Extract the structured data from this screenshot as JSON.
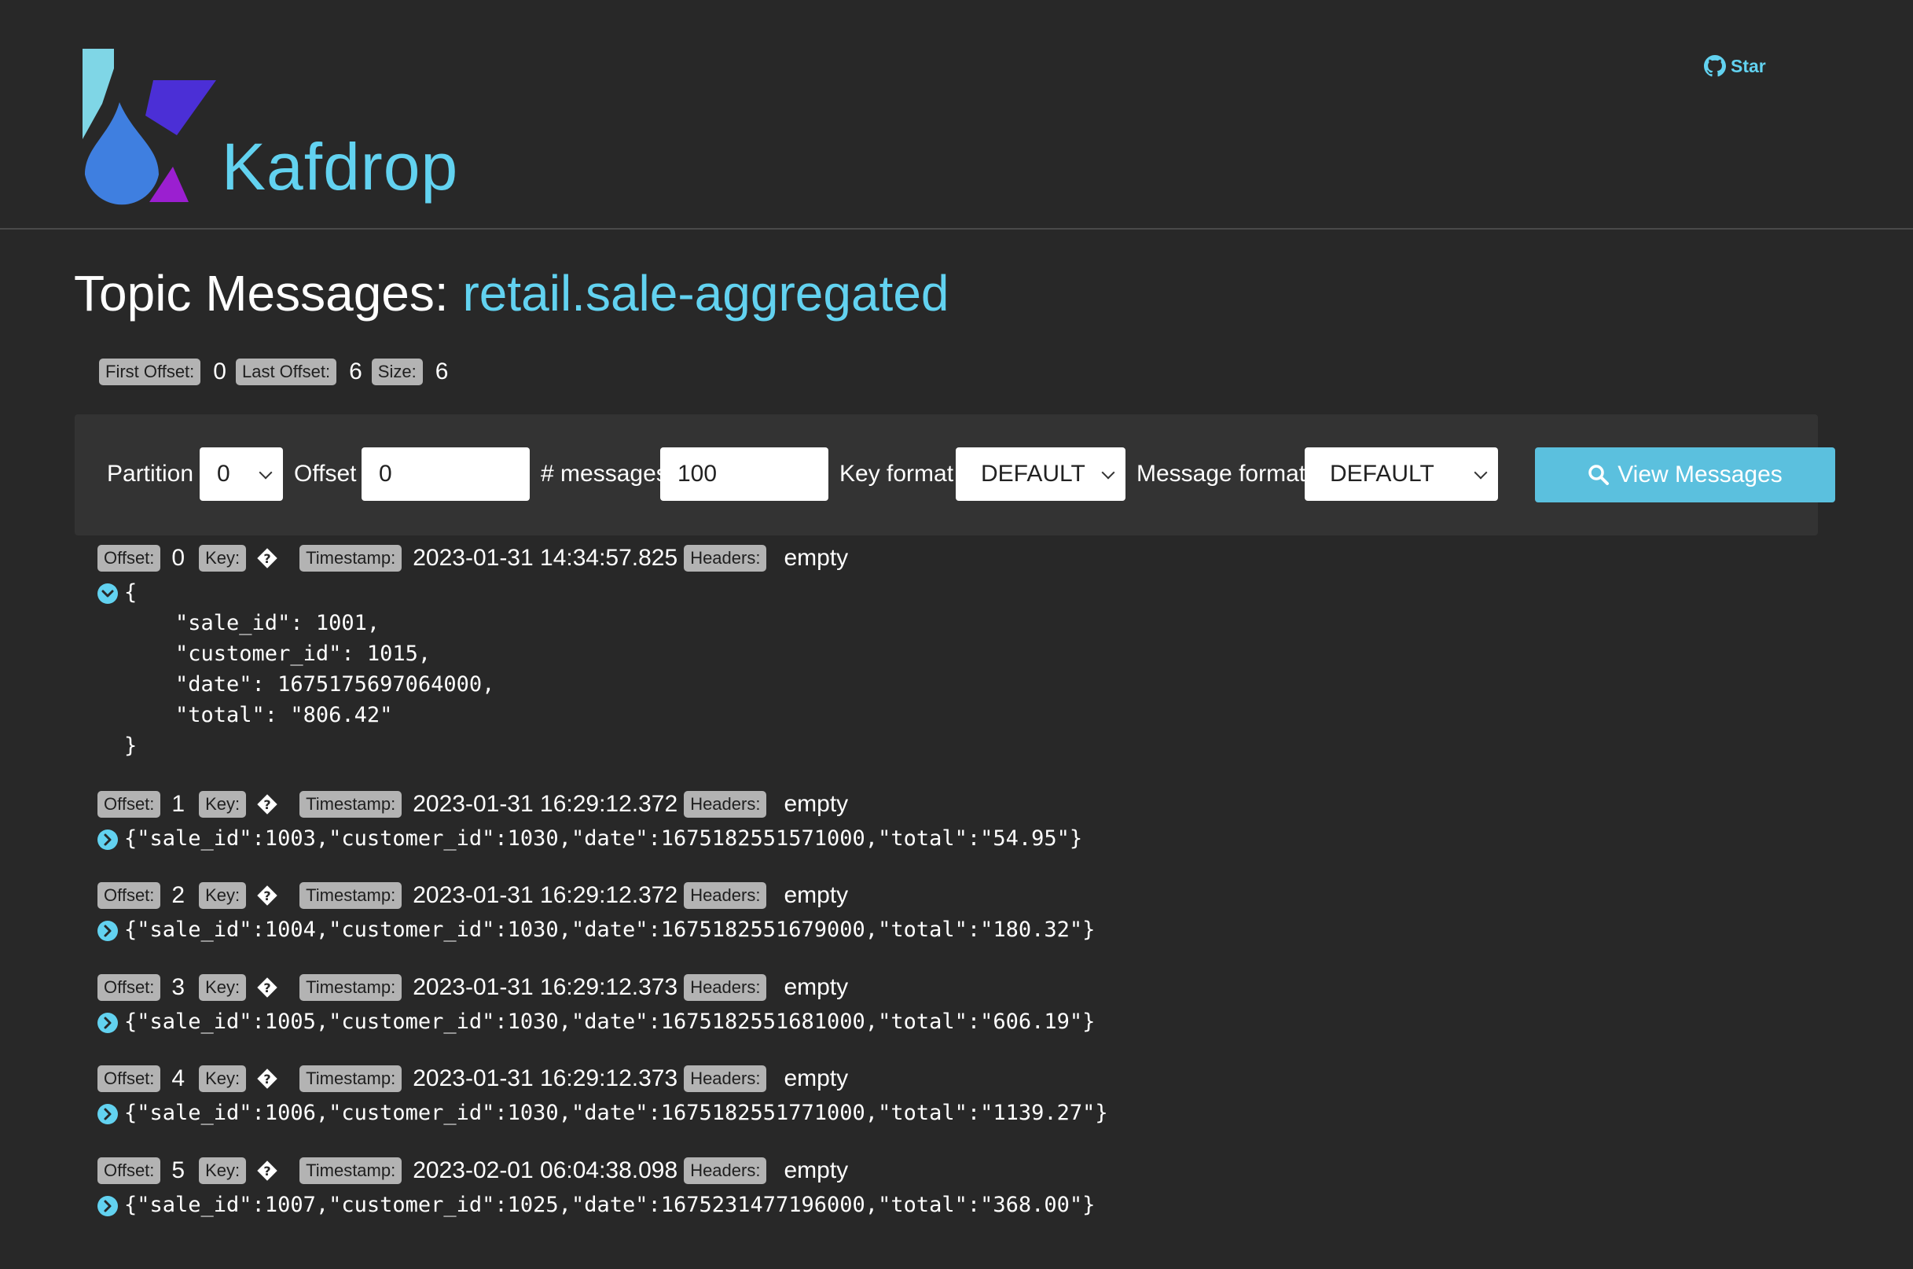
{
  "header": {
    "brand": "Kafdrop",
    "star_label": "Star"
  },
  "title": {
    "prefix": "Topic Messages: ",
    "topic": "retail.sale-aggregated"
  },
  "stats": {
    "first_offset_label": "First Offset:",
    "first_offset": "0",
    "last_offset_label": "Last Offset:",
    "last_offset": "6",
    "size_label": "Size:",
    "size": "6"
  },
  "form": {
    "partition_label": "Partition",
    "partition_value": "0",
    "offset_label": "Offset",
    "offset_value": "0",
    "messages_label": "# messages",
    "messages_value": "100",
    "key_format_label": "Key format",
    "key_format_value": "DEFAULT",
    "message_format_label": "Message format",
    "message_format_value": "DEFAULT",
    "view_button": "View Messages"
  },
  "labels": {
    "offset": "Offset:",
    "key": "Key:",
    "timestamp": "Timestamp:",
    "headers": "Headers:"
  },
  "messages": [
    {
      "offset": "0",
      "timestamp": "2023-01-31 14:34:57.825",
      "headers": "empty",
      "expanded": true,
      "body": "{\n    \"sale_id\": 1001,\n    \"customer_id\": 1015,\n    \"date\": 1675175697064000,\n    \"total\": \"806.42\"\n}"
    },
    {
      "offset": "1",
      "timestamp": "2023-01-31 16:29:12.372",
      "headers": "empty",
      "expanded": false,
      "body": "{\"sale_id\":1003,\"customer_id\":1030,\"date\":1675182551571000,\"total\":\"54.95\"}"
    },
    {
      "offset": "2",
      "timestamp": "2023-01-31 16:29:12.372",
      "headers": "empty",
      "expanded": false,
      "body": "{\"sale_id\":1004,\"customer_id\":1030,\"date\":1675182551679000,\"total\":\"180.32\"}"
    },
    {
      "offset": "3",
      "timestamp": "2023-01-31 16:29:12.373",
      "headers": "empty",
      "expanded": false,
      "body": "{\"sale_id\":1005,\"customer_id\":1030,\"date\":1675182551681000,\"total\":\"606.19\"}"
    },
    {
      "offset": "4",
      "timestamp": "2023-01-31 16:29:12.373",
      "headers": "empty",
      "expanded": false,
      "body": "{\"sale_id\":1006,\"customer_id\":1030,\"date\":1675182551771000,\"total\":\"1139.27\"}"
    },
    {
      "offset": "5",
      "timestamp": "2023-02-01 06:04:38.098",
      "headers": "empty",
      "expanded": false,
      "body": "{\"sale_id\":1007,\"customer_id\":1025,\"date\":1675231477196000,\"total\":\"368.00\"}"
    }
  ],
  "colors": {
    "accent": "#62d2f0",
    "button": "#5bc0de",
    "background": "#282828",
    "badge": "#b3b3b3"
  }
}
